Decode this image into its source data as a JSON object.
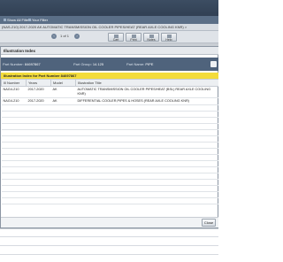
{
  "header": {
    "app_text": ""
  },
  "filters": {
    "items": [
      {
        "label": "Show All Filters"
      },
      {
        "label": "Your Filter"
      }
    ]
  },
  "breadcrumb": {
    "text": "(NAS-210)  2017-2020  AK  AUTOMATIC TRANSMISSION OIL COOLER PIPES/HEAT (REAR AXLE COOLING KNR) >"
  },
  "toolbar": {
    "prev_glyph": "‹",
    "next_glyph": "›",
    "page_text": "1 of 1",
    "buttons": [
      {
        "label": "Cart"
      },
      {
        "label": "Print"
      },
      {
        "label": "Notes"
      },
      {
        "label": "Help"
      }
    ]
  },
  "dialog": {
    "title": "Illustration Index",
    "part_number_label": "Part Number:",
    "part_number_value": "84697867",
    "part_group_label": "Part Group:",
    "part_group_value": "14.125",
    "part_name_label": "Part Name:",
    "part_name_value": "PIPE",
    "index_header": "Illustration Index for Part Number 84697867",
    "columns": [
      "Ill Number",
      "Years",
      "Model",
      "Illustration Title"
    ],
    "rows": [
      {
        "ill_number": "NAG4-210",
        "years": "2017-2020",
        "model": "AK",
        "title": "AUTOMATIC TRANSMISSION OIL COOLER PIPES/HEAT (BSL) REAR AXLE COOLING KNR)"
      },
      {
        "ill_number": "NAG4-210",
        "years": "2017-2020",
        "model": "AK",
        "title": "DIFFERENTIAL COOLER,PIPES & HOSES (REAR AXLE COOLING KNR)"
      }
    ],
    "close_label": "Close"
  },
  "colors": {
    "header_bg": "#2d3b4e",
    "band_bg": "#4f637c",
    "index_header_bg": "#f3dc3c"
  }
}
